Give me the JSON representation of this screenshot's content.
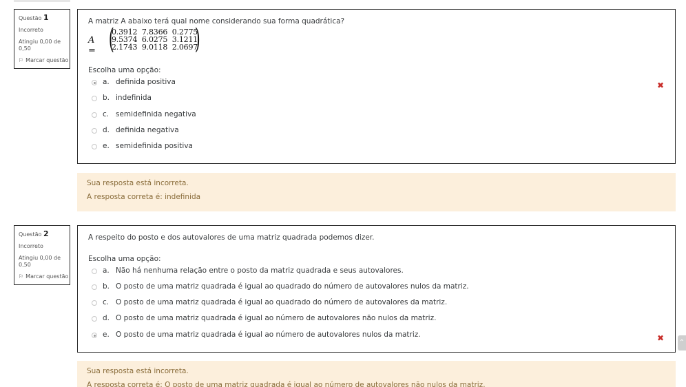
{
  "questions": [
    {
      "info": {
        "label": "Questão",
        "number": "1",
        "state": "Incorreto",
        "grade": "Atingiu 0,00 de 0,50",
        "flag_label": "Marcar questão"
      },
      "text": "A matriz A abaixo terá qual nome considerando sua forma quadrática?",
      "matrix": {
        "lhs": "A =",
        "rows": [
          "0.3912  7.8366  0.2775",
          "9.5374  6.0275  3.1211",
          "2.1743  9.0118  2.0697"
        ]
      },
      "prompt": "Escolha uma opção:",
      "options": [
        {
          "letter": "a.",
          "text": "definida positiva",
          "checked": true
        },
        {
          "letter": "b.",
          "text": "indefinida",
          "checked": false
        },
        {
          "letter": "c.",
          "text": "semidefinida negativa",
          "checked": false
        },
        {
          "letter": "d.",
          "text": "definida negativa",
          "checked": false
        },
        {
          "letter": "e.",
          "text": "semidefinida positiva",
          "checked": false
        }
      ],
      "feedback": {
        "status": "Sua resposta está incorreta.",
        "correct": "A resposta correta é: indefinida"
      }
    },
    {
      "info": {
        "label": "Questão",
        "number": "2",
        "state": "Incorreto",
        "grade": "Atingiu 0,00 de 0,50",
        "flag_label": "Marcar questão"
      },
      "text": "A respeito do posto e dos autovalores de uma matriz quadrada podemos dizer.",
      "prompt": "Escolha uma opção:",
      "options": [
        {
          "letter": "a.",
          "text": "Não há nenhuma relação entre o posto da matriz quadrada e seus autovalores.",
          "checked": false
        },
        {
          "letter": "b.",
          "text": "O posto de uma matriz quadrada é igual ao quadrado do número de autovalores nulos da matriz.",
          "checked": false
        },
        {
          "letter": "c.",
          "text": "O posto de uma matriz quadrada é igual ao quadrado do número de autovalores da matriz.",
          "checked": false
        },
        {
          "letter": "d.",
          "text": "O posto de uma matriz quadrada é igual ao número de autovalores não nulos da matriz.",
          "checked": false
        },
        {
          "letter": "e.",
          "text": "O posto de uma matriz quadrada é igual ao número de autovalores nulos da matriz.",
          "checked": true
        }
      ],
      "feedback": {
        "status": "Sua resposta está incorreta.",
        "correct": "A resposta correta é: O posto de uma matriz quadrada é igual ao número de autovalores não nulos da matriz."
      }
    }
  ],
  "icons": {
    "incorrect_mark": "✖",
    "flag": "⚐",
    "scroll_up": "⌃"
  },
  "colors": {
    "incorrect": "#c9302c",
    "feedback_bg": "#fcefdc",
    "feedback_text": "#8a6d3b"
  }
}
